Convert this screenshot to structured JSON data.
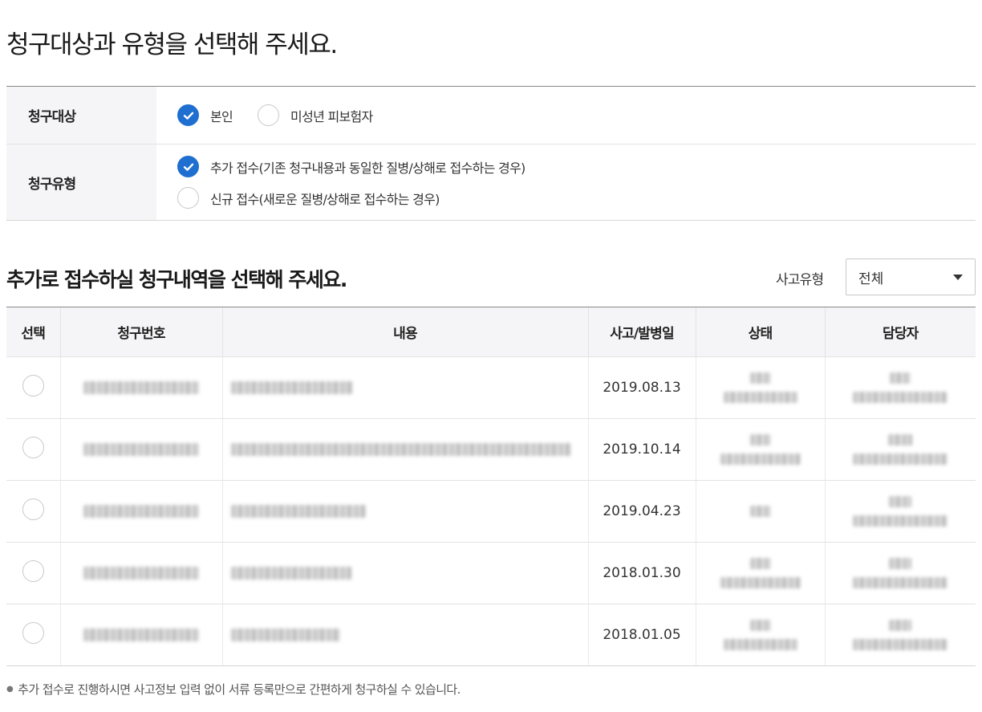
{
  "page_title": "청구대상과 유형을 선택해 주세요.",
  "claim_form": {
    "target": {
      "label": "청구대상",
      "options": [
        {
          "label": "본인",
          "checked": true
        },
        {
          "label": "미성년 피보험자",
          "checked": false
        }
      ]
    },
    "type": {
      "label": "청구유형",
      "options": [
        {
          "label": "추가 접수(기존 청구내용과 동일한 질병/상해로 접수하는 경우)",
          "checked": true
        },
        {
          "label": "신규 접수(새로운 질병/상해로 접수하는 경우)",
          "checked": false
        }
      ]
    }
  },
  "history": {
    "title": "추가로 접수하실 청구내역을 선택해 주세요.",
    "filter_label": "사고유형",
    "filter_value": "전체",
    "columns": [
      "선택",
      "청구번호",
      "내용",
      "사고/발병일",
      "상태",
      "담당자"
    ],
    "rows": [
      {
        "date": "2019.08.13"
      },
      {
        "date": "2019.10.14"
      },
      {
        "date": "2019.04.23"
      },
      {
        "date": "2018.01.30"
      },
      {
        "date": "2018.01.05"
      }
    ]
  },
  "note": "추가 접수로 진행하시면 사고정보 입력 없이 서류 등록만으로 간편하게 청구하실 수 있습니다.",
  "colors": {
    "accent": "#1f6fd1",
    "header_bg": "#f5f5f7"
  }
}
